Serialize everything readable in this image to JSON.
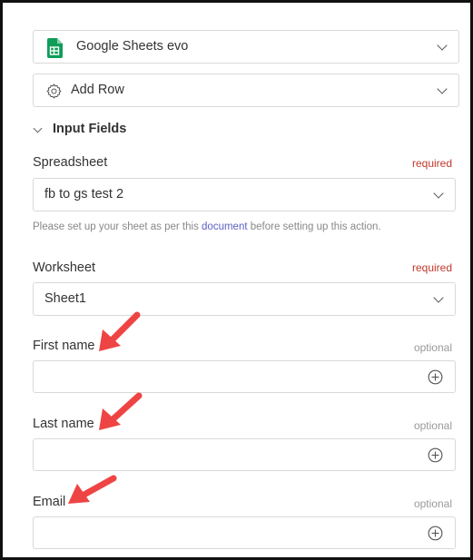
{
  "app": {
    "name": "Google Sheets evo",
    "action": "Add Row"
  },
  "section": {
    "title": "Input Fields"
  },
  "spreadsheet": {
    "label": "Spreadsheet",
    "badge": "required",
    "value": "fb to gs test 2",
    "hint_before": "Please set up your sheet as per this ",
    "hint_link": "document",
    "hint_after": " before setting up this action."
  },
  "worksheet": {
    "label": "Worksheet",
    "badge": "required",
    "value": "Sheet1"
  },
  "fields": [
    {
      "label": "First name",
      "badge": "optional",
      "value": ""
    },
    {
      "label": "Last name",
      "badge": "optional",
      "value": ""
    },
    {
      "label": "Email",
      "badge": "optional",
      "value": ""
    }
  ],
  "colors": {
    "required": "#c0392b",
    "optional": "#999999",
    "link": "#5b62c4",
    "annotation_arrow": "#ef4444",
    "sheets_green": "#0f9d58"
  },
  "icons": [
    "google-sheets-icon",
    "gear-icon",
    "chevron-down-icon",
    "plus-circle-icon",
    "annotation-arrow"
  ]
}
